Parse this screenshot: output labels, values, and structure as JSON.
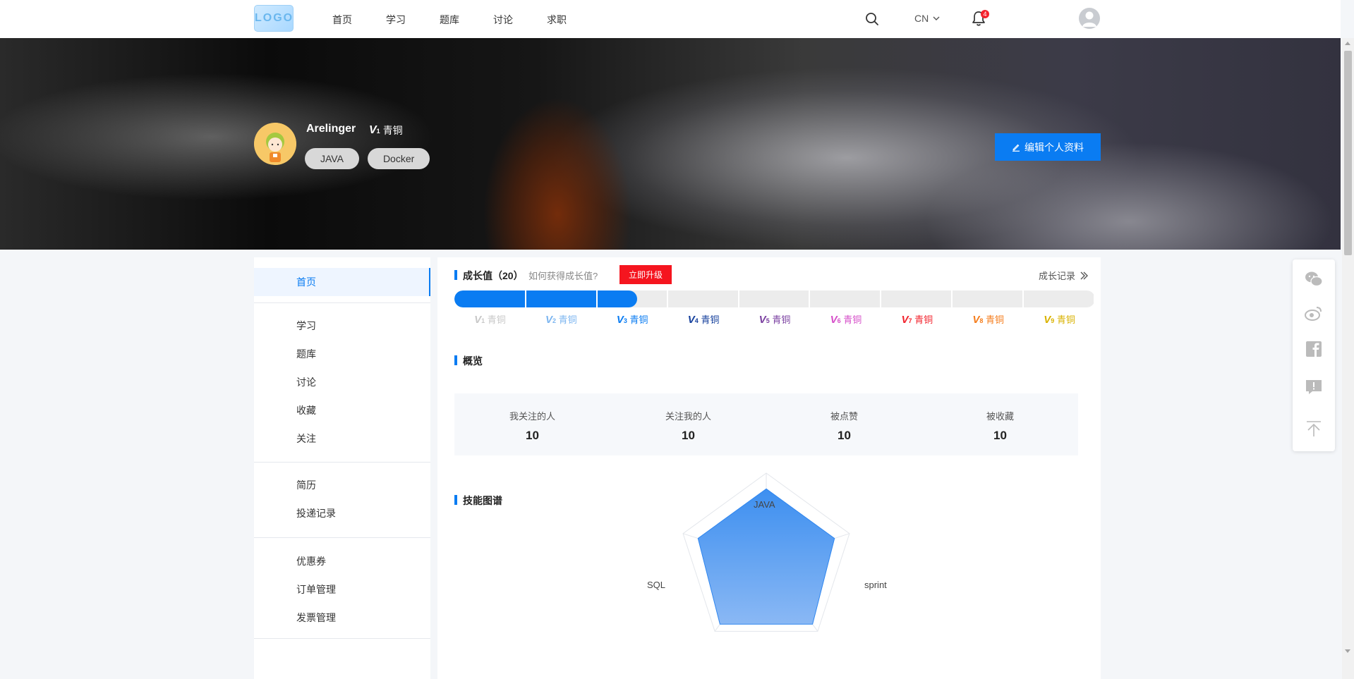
{
  "nav": {
    "logo": "LOGO",
    "items": [
      "首页",
      "学习",
      "题库",
      "讨论",
      "求职"
    ],
    "lang": "CN",
    "notification_count": "4"
  },
  "profile": {
    "name": "Arelinger",
    "level_mark": "V",
    "level_num": "1",
    "level_name": "青铜",
    "tags": [
      "JAVA",
      "Docker"
    ],
    "edit_label": "编辑个人资料"
  },
  "sidebar": {
    "items": [
      "首页",
      "学习",
      "题库",
      "讨论",
      "收藏",
      "关注",
      "简历",
      "投递记录",
      "优惠券",
      "订单管理",
      "发票管理"
    ]
  },
  "growth": {
    "title": "成长值（20）",
    "hint": "如何获得成长值?",
    "upgrade_label": "立即升级",
    "log_label": "成长记录",
    "progress_fraction": 0.285,
    "levels": [
      {
        "mark": "V",
        "num": "1",
        "name": "青铜",
        "color": "#c8c8c8"
      },
      {
        "mark": "V",
        "num": "2",
        "name": "青铜",
        "color": "#7db6f0"
      },
      {
        "mark": "V",
        "num": "3",
        "name": "青铜",
        "color": "#0a7cf2"
      },
      {
        "mark": "V",
        "num": "4",
        "name": "青铜",
        "color": "#143f9c"
      },
      {
        "mark": "V",
        "num": "5",
        "name": "青铜",
        "color": "#7a3fa0"
      },
      {
        "mark": "V",
        "num": "6",
        "name": "青铜",
        "color": "#d64fc9"
      },
      {
        "mark": "V",
        "num": "7",
        "name": "青铜",
        "color": "#f2232d"
      },
      {
        "mark": "V",
        "num": "8",
        "name": "青铜",
        "color": "#f57d1c"
      },
      {
        "mark": "V",
        "num": "9",
        "name": "青铜",
        "color": "#d9b200"
      }
    ]
  },
  "overview": {
    "title": "概览",
    "stats": [
      {
        "label": "我关注的人",
        "value": "10"
      },
      {
        "label": "关注我的人",
        "value": "10"
      },
      {
        "label": "被点赞",
        "value": "10"
      },
      {
        "label": "被收藏",
        "value": "10"
      }
    ]
  },
  "skills": {
    "title": "技能图谱",
    "axes": [
      "JAVA",
      "sprint",
      "",
      "",
      "SQL"
    ],
    "values": [
      0.82,
      0.82,
      0.9,
      0.9,
      0.82
    ]
  },
  "float_tools": [
    "wechat-icon",
    "weibo-icon",
    "facebook-icon",
    "feedback-icon",
    "back-to-top-icon"
  ],
  "colors": {
    "accent": "#0a7cf2",
    "upgrade": "#f5151f"
  }
}
